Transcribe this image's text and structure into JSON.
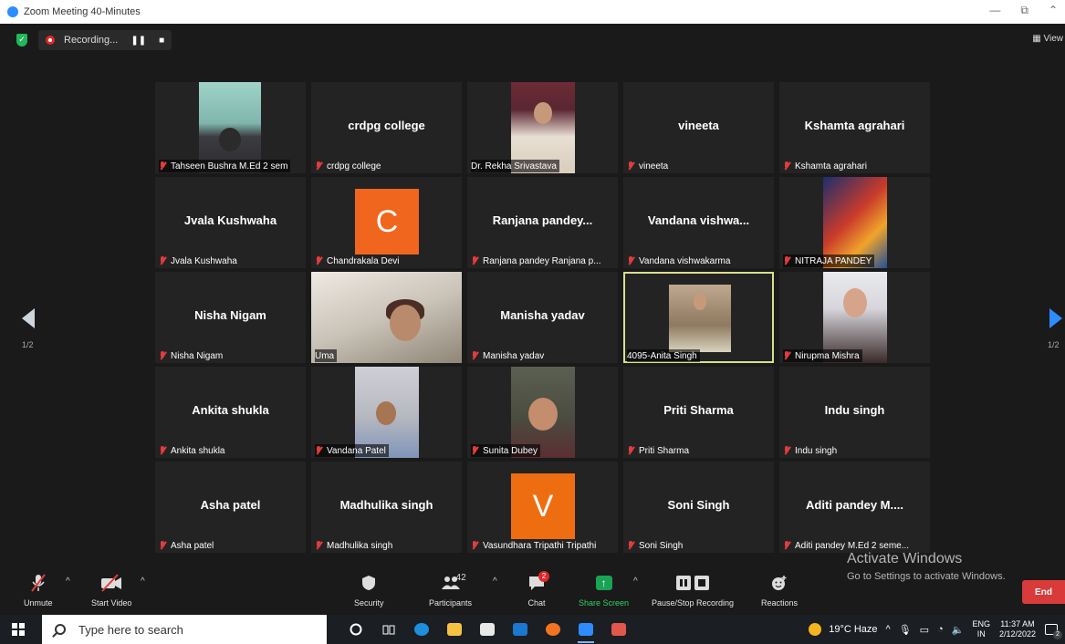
{
  "window": {
    "title": "Zoom Meeting 40-Minutes"
  },
  "topbar": {
    "recording_label": "Recording...",
    "pause_label": "❚❚",
    "stop_label": "■",
    "view_label": "View"
  },
  "grid": {
    "page_indicator_left": "1/2",
    "page_indicator_right": "1/2",
    "tiles": [
      {
        "big": "",
        "label": "Tahseen Bushra M.Ed 2 sem"
      },
      {
        "big": "crdpg college",
        "label": "crdpg college"
      },
      {
        "big": "",
        "label": "Dr. Rekha Srivastava"
      },
      {
        "big": "vineeta",
        "label": "vineeta"
      },
      {
        "big": "Kshamta agrahari",
        "label": "Kshamta agrahari"
      },
      {
        "big": "Jvala Kushwaha",
        "label": "Jvala Kushwaha"
      },
      {
        "big": "",
        "label": "Chandrakala Devi",
        "avatar": "C"
      },
      {
        "big": "Ranjana pandey...",
        "label": "Ranjana pandey Ranjana p..."
      },
      {
        "big": "Vandana vishwa...",
        "label": "Vandana vishwakarma"
      },
      {
        "big": "",
        "label": "NITRAJA PANDEY"
      },
      {
        "big": "Nisha Nigam",
        "label": "Nisha Nigam"
      },
      {
        "big": "",
        "label": "Uma"
      },
      {
        "big": "Manisha yadav",
        "label": "Manisha yadav"
      },
      {
        "big": "",
        "label": "4095-Anita Singh"
      },
      {
        "big": "",
        "label": "Nirupma Mishra"
      },
      {
        "big": "Ankita shukla",
        "label": "Ankita shukla"
      },
      {
        "big": "",
        "label": "Vandana Patel"
      },
      {
        "big": "",
        "label": "Sunita Dubey"
      },
      {
        "big": "Priti Sharma",
        "label": "Priti Sharma"
      },
      {
        "big": "Indu singh",
        "label": "Indu singh"
      },
      {
        "big": "Asha patel",
        "label": "Asha patel"
      },
      {
        "big": "Madhulika singh",
        "label": "Madhulika singh"
      },
      {
        "big": "",
        "label": "Vasundhara Tripathi Tripathi",
        "avatar": "V"
      },
      {
        "big": "Soni Singh",
        "label": "Soni Singh"
      },
      {
        "big": "Aditi pandey M....",
        "label": "Aditi pandey M.Ed 2 seme..."
      }
    ]
  },
  "watermark": {
    "line1": "Activate Windows",
    "line2": "Go to Settings to activate Windows."
  },
  "toolbar": {
    "unmute": "Unmute",
    "start_video": "Start Video",
    "security": "Security",
    "participants": "Participants",
    "participants_count": "42",
    "chat": "Chat",
    "chat_badge": "2",
    "share_screen": "Share Screen",
    "pause_stop_recording": "Pause/Stop Recording",
    "reactions": "Reactions",
    "end": "End"
  },
  "taskbar": {
    "search_placeholder": "Type here to search",
    "weather": "19°C  Haze",
    "lang_top": "ENG",
    "lang_bottom": "IN",
    "time": "11:37 AM",
    "date": "2/12/2022",
    "notif_count": "2"
  }
}
